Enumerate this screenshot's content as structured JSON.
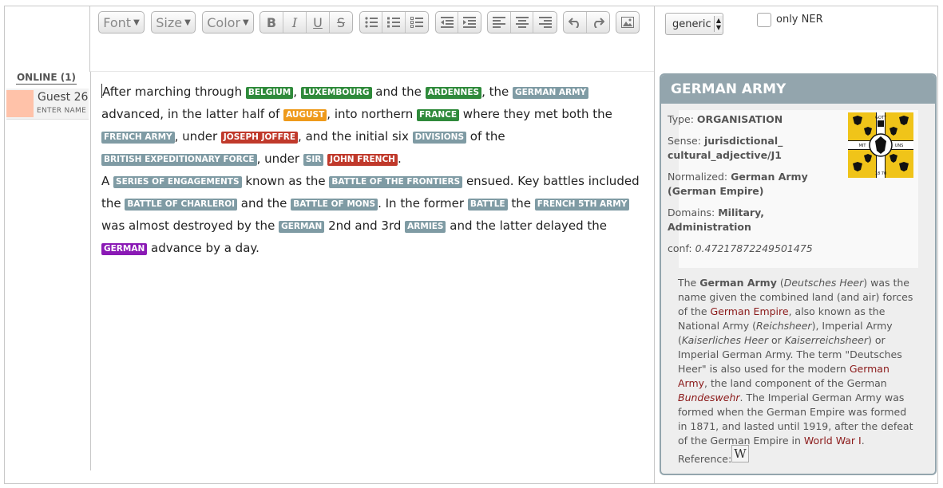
{
  "toolbar": {
    "font_label": "Font",
    "size_label": "Size",
    "color_label": "Color",
    "bold": "B",
    "italic": "I",
    "underline": "U",
    "strike": "S"
  },
  "sidebar": {
    "online_header": "ONLINE (1)",
    "guest_name": "Guest 26",
    "enter_name": "ENTER NAME",
    "guest_color": "#ffc2a9"
  },
  "editor": {
    "p1": [
      {
        "t": "After marching through "
      },
      {
        "tag": "BELGIUM",
        "c": "green"
      },
      {
        "t": ", "
      },
      {
        "tag": "LUXEMBOURG",
        "c": "green"
      },
      {
        "t": " and the "
      },
      {
        "tag": "ARDENNES",
        "c": "green"
      },
      {
        "t": ", the "
      },
      {
        "tag": "GERMAN ARMY",
        "c": "gray"
      },
      {
        "t": " advanced, in the latter half of "
      },
      {
        "tag": "AUGUST",
        "c": "orange"
      },
      {
        "t": ", into northern "
      },
      {
        "tag": "FRANCE",
        "c": "green"
      },
      {
        "t": " where they met both the "
      },
      {
        "tag": "FRENCH ARMY",
        "c": "gray"
      },
      {
        "t": ", under "
      },
      {
        "tag": "JOSEPH JOFFRE",
        "c": "red"
      },
      {
        "t": ", and the initial six "
      },
      {
        "tag": "DIVISIONS",
        "c": "gray"
      },
      {
        "t": " of the "
      },
      {
        "tag": "BRITISH EXPEDITIONARY FORCE",
        "c": "gray"
      },
      {
        "t": ", under "
      },
      {
        "tag": "SIR",
        "c": "gray"
      },
      {
        "t": " "
      },
      {
        "tag": "JOHN FRENCH",
        "c": "red"
      },
      {
        "t": "."
      }
    ],
    "p2": [
      {
        "t": "A "
      },
      {
        "tag": "SERIES OF ENGAGEMENTS",
        "c": "gray"
      },
      {
        "t": " known as the "
      },
      {
        "tag": "BATTLE OF THE FRONTIERS",
        "c": "gray"
      },
      {
        "t": " ensued. Key battles included the "
      },
      {
        "tag": "BATTLE OF CHARLEROI",
        "c": "gray"
      },
      {
        "t": " and the "
      },
      {
        "tag": "BATTLE OF MONS",
        "c": "gray"
      },
      {
        "t": ". In the former "
      },
      {
        "tag": "BATTLE",
        "c": "gray"
      },
      {
        "t": " the "
      },
      {
        "tag": "FRENCH 5TH ARMY",
        "c": "gray"
      },
      {
        "t": " was almost destroyed by the "
      },
      {
        "tag": "GERMAN",
        "c": "gray"
      },
      {
        "t": " 2nd and 3rd "
      },
      {
        "tag": "ARMIES",
        "c": "gray"
      },
      {
        "t": " and the latter delayed the "
      },
      {
        "tag": "GERMAN",
        "c": "purple"
      },
      {
        "t": " advance by a day."
      }
    ]
  },
  "controls": {
    "lang_value": "generic",
    "only_ner_label": "only NER"
  },
  "panel": {
    "title": "GERMAN ARMY",
    "type_label": "Type:",
    "type_value": "ORGANISATION",
    "sense_label": "Sense:",
    "sense_value_1": "jurisdictional_",
    "sense_value_2": "cultural_adjective/J1",
    "normalized_label": "Normalized:",
    "normalized_value_1": "German Army",
    "normalized_value_2": "(German Empire)",
    "domains_label": "Domains:",
    "domains_value_1": "Military,",
    "domains_value_2": "Administration",
    "conf_label": "conf:",
    "conf_value": "0.47217872249501475",
    "flag_text_top": "GOTT",
    "flag_text_left": "MIT",
    "flag_text_right": "UNS",
    "flag_years": "18 70",
    "reference_label": "Reference:",
    "wiki_letter": "W"
  },
  "description": {
    "s1": "The ",
    "b1": "German Army",
    "s2": " (",
    "i1": "Deutsches Heer",
    "s3": ") was the name given the combined land (and air) forces of the ",
    "l1": "German Empire",
    "s4": ", also known as the National Army (",
    "i2": "Reichsheer",
    "s5": "), Imperial Army (",
    "i3": "Kaiserliches Heer",
    "s6": " or ",
    "i4": "Kaiserreichsheer",
    "s7": ") or Imperial German Army. The term \"Deutsches Heer\" is also used for the modern ",
    "l2": "German Army",
    "s8": ", the land component of the German ",
    "l3": "Bundeswehr",
    "s9": ". The Imperial German Army was formed when the German Empire was formed in 1871, and lasted until 1919, after the defeat of the German Empire in ",
    "l4": "World War I",
    "s10": "."
  }
}
